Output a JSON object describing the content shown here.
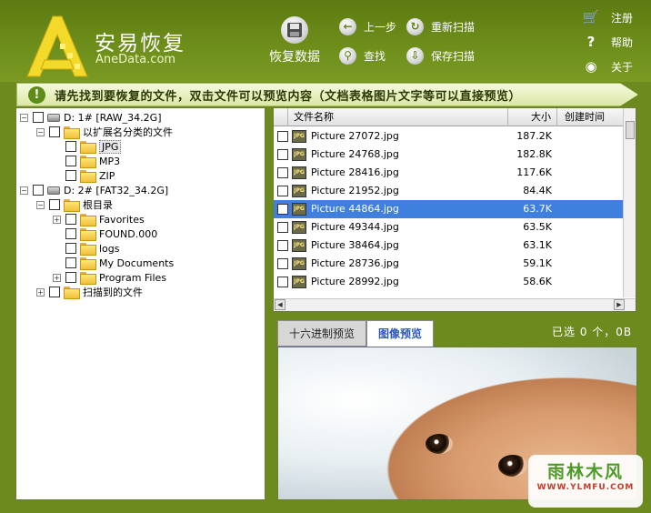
{
  "app": {
    "title": "安易恢复",
    "subtitle": "AneData.com"
  },
  "toolbar": {
    "recover_label": "恢复数据",
    "prev_label": "上一步",
    "rescan_label": "重新扫描",
    "find_label": "查找",
    "save_scan_label": "保存扫描"
  },
  "side_menu": {
    "register_label": "注册",
    "help_label": "帮助",
    "about_label": "关于"
  },
  "notice": "请先找到要恢复的文件，双击文件可以预览内容（文档表格图片文字等可以直接预览）",
  "tree": {
    "drive1": "D:  1# [RAW_34.2G]",
    "drive1_group": "以扩展名分类的文件",
    "drive1_children": [
      "JPG",
      "MP3",
      "ZIP"
    ],
    "drive2": "D:  2# [FAT32_34.2G]",
    "drive2_root": "根目录",
    "drive2_children": [
      "Favorites",
      "FOUND.000",
      "logs",
      "My Documents",
      "Program Files"
    ],
    "scanned": "扫描到的文件"
  },
  "file_list": {
    "columns": [
      "文件名称",
      "大小",
      "创建时间"
    ],
    "rows": [
      {
        "name": "Picture 27072.jpg",
        "size": "187.2K"
      },
      {
        "name": "Picture 24768.jpg",
        "size": "182.8K"
      },
      {
        "name": "Picture 28416.jpg",
        "size": "117.6K"
      },
      {
        "name": "Picture 21952.jpg",
        "size": "84.4K"
      },
      {
        "name": "Picture 44864.jpg",
        "size": "63.7K"
      },
      {
        "name": "Picture 49344.jpg",
        "size": "63.5K"
      },
      {
        "name": "Picture 38464.jpg",
        "size": "63.1K"
      },
      {
        "name": "Picture 28736.jpg",
        "size": "59.1K"
      },
      {
        "name": "Picture 28992.jpg",
        "size": "58.6K"
      }
    ],
    "file_badge": "JPG",
    "selected_index": 4
  },
  "preview": {
    "tabs": [
      "十六进制预览",
      "图像预览"
    ],
    "active_tab": 1,
    "selection_info": "已选 0 个，0B"
  },
  "watermark": {
    "line1": "雨林木风",
    "line2": "WWW.YLMFU.COM"
  },
  "colors": {
    "header_green": "#6f8f1c",
    "highlight_row": "#3f7fde",
    "active_tab_text": "#2b56c2"
  }
}
